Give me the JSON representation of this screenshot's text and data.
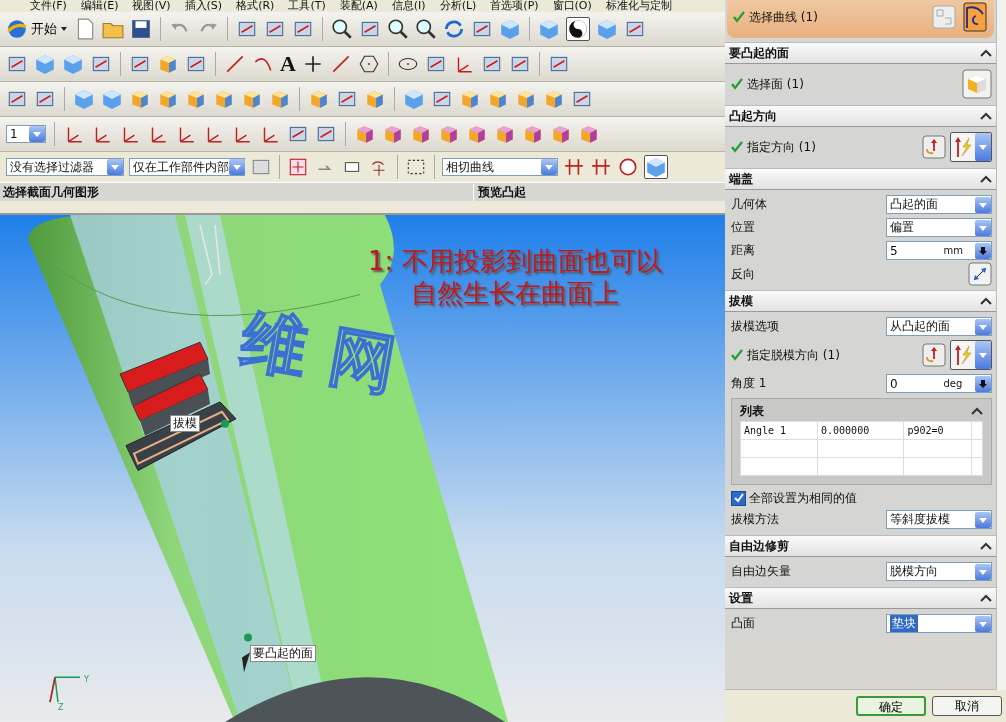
{
  "menu_bar": [
    "文件(F)",
    "编辑(E)",
    "视图(V)",
    "插入(S)",
    "格式(R)",
    "工具(T)",
    "装配(A)",
    "信息(I)",
    "分析(L)",
    "首选项(P)",
    "窗口(O)",
    "标准化与定制"
  ],
  "toolbar": {
    "start_button": "开始",
    "text_tool": "A",
    "layer_select": "1"
  },
  "filter_bar": {
    "type_filter": "没有选择过滤器",
    "scope_filter": "仅在工作部件内部",
    "curve_rule": "相切曲线"
  },
  "cue_line": {
    "prompt": "选择截面几何图形",
    "status": "预览凸起"
  },
  "viewport": {
    "annotation": [
      "1: 不用投影到曲面也可以",
      "自然生长在曲面上"
    ],
    "model_text": "维网",
    "labels": [
      "拔模",
      "要凸起的面"
    ],
    "axis_labels": [
      "Y",
      "Z"
    ]
  },
  "dialog": {
    "sections": [
      {
        "active": true,
        "rows": [
          {
            "kind": "curve-select",
            "label": "选择曲线 (1)"
          }
        ]
      },
      {
        "title": "要凸起的面",
        "expanded": true,
        "active": false,
        "rows": [
          {
            "kind": "face-select",
            "label": "选择面 (1)"
          }
        ]
      },
      {
        "title": "凸起方向",
        "expanded": true,
        "active": false,
        "rows": [
          {
            "kind": "vector-select",
            "label": "指定方向 (1)"
          }
        ]
      },
      {
        "title": "端盖",
        "expanded": true,
        "active": false,
        "rows": [
          {
            "kind": "dropdown",
            "label": "几何体",
            "value": "凸起的面"
          },
          {
            "kind": "dropdown",
            "label": "位置",
            "value": "偏置"
          },
          {
            "kind": "number",
            "label": "距离",
            "value": "5",
            "unit": "mm"
          },
          {
            "kind": "button",
            "label": "反向"
          }
        ]
      },
      {
        "title": "拔模",
        "expanded": true,
        "active": false,
        "rows": [
          {
            "kind": "dropdown",
            "label": "拔模选项",
            "value": "从凸起的面"
          },
          {
            "kind": "vector-select",
            "label": "指定脱模方向 (1)"
          },
          {
            "kind": "number",
            "label": "角度 1",
            "value": "0",
            "unit": "deg"
          },
          {
            "kind": "list",
            "label": "列表",
            "expanded": true,
            "rows": [
              [
                "Angle 1",
                "0.000000",
                "p902=0",
                ""
              ],
              [
                "",
                "",
                "",
                ""
              ],
              [
                "",
                "",
                "",
                ""
              ]
            ]
          },
          {
            "kind": "checkbox",
            "label": "全部设置为相同的值",
            "checked": true
          },
          {
            "kind": "dropdown",
            "label": "拔模方法",
            "value": "等斜度拔模"
          }
        ]
      },
      {
        "title": "自由边修剪",
        "expanded": true,
        "active": false,
        "rows": [
          {
            "kind": "dropdown",
            "label": "自由边矢量",
            "value": "脱模方向"
          }
        ]
      },
      {
        "title": "设置",
        "expanded": true,
        "active": false,
        "rows": [
          {
            "kind": "dropdown",
            "label": "凸面",
            "value": "垫块",
            "highlighted": true
          }
        ]
      }
    ],
    "buttons": [
      "确定",
      "取消"
    ]
  }
}
